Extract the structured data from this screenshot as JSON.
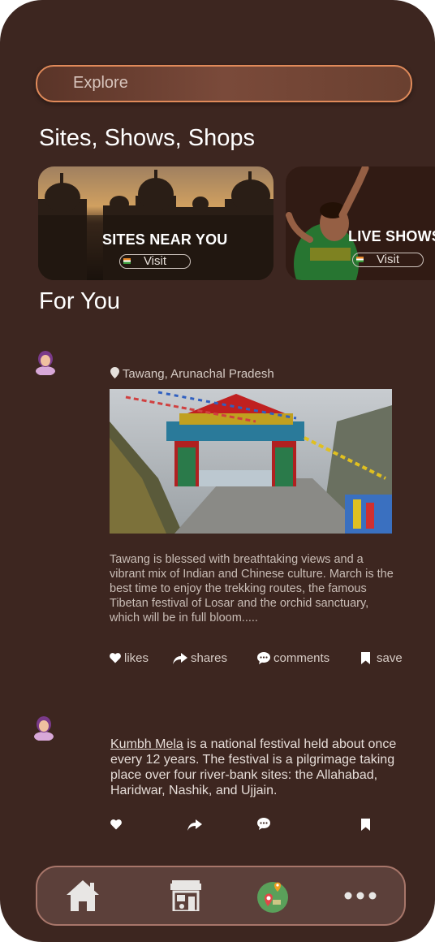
{
  "search": {
    "placeholder": "Explore"
  },
  "sections": {
    "sites_title": "Sites, Shows, Shops",
    "for_you_title": "For You"
  },
  "cards": [
    {
      "title": "SITES NEAR YOU",
      "button": "Visit"
    },
    {
      "title": "LIVE SHOWS",
      "button": "Visit"
    }
  ],
  "posts": [
    {
      "location": "Tawang, Arunachal Pradesh",
      "text": "Tawang is blessed with breathtaking views and a vibrant mix of Indian and Chinese culture. March is the best time to enjoy the trekking routes, the famous Tibetan festival of Losar and the orchid sanctuary, which will be in full bloom.....",
      "actions": {
        "likes": "likes",
        "shares": "shares",
        "comments": "comments",
        "save": "save"
      }
    },
    {
      "link": "Kumbh Mela",
      "text": " is a national festival held about once every 12 years. The festival is a pilgrimage taking place over four river-bank sites: the Allahabad, Haridwar, Nashik, and Ujjain."
    }
  ],
  "nav": {
    "items": [
      "home-icon",
      "shop-icon",
      "map-pin-icon",
      "more-icon"
    ]
  },
  "colors": {
    "background": "#3d2620",
    "accent": "#e08a5a",
    "nav_bg": "#5c403a"
  }
}
